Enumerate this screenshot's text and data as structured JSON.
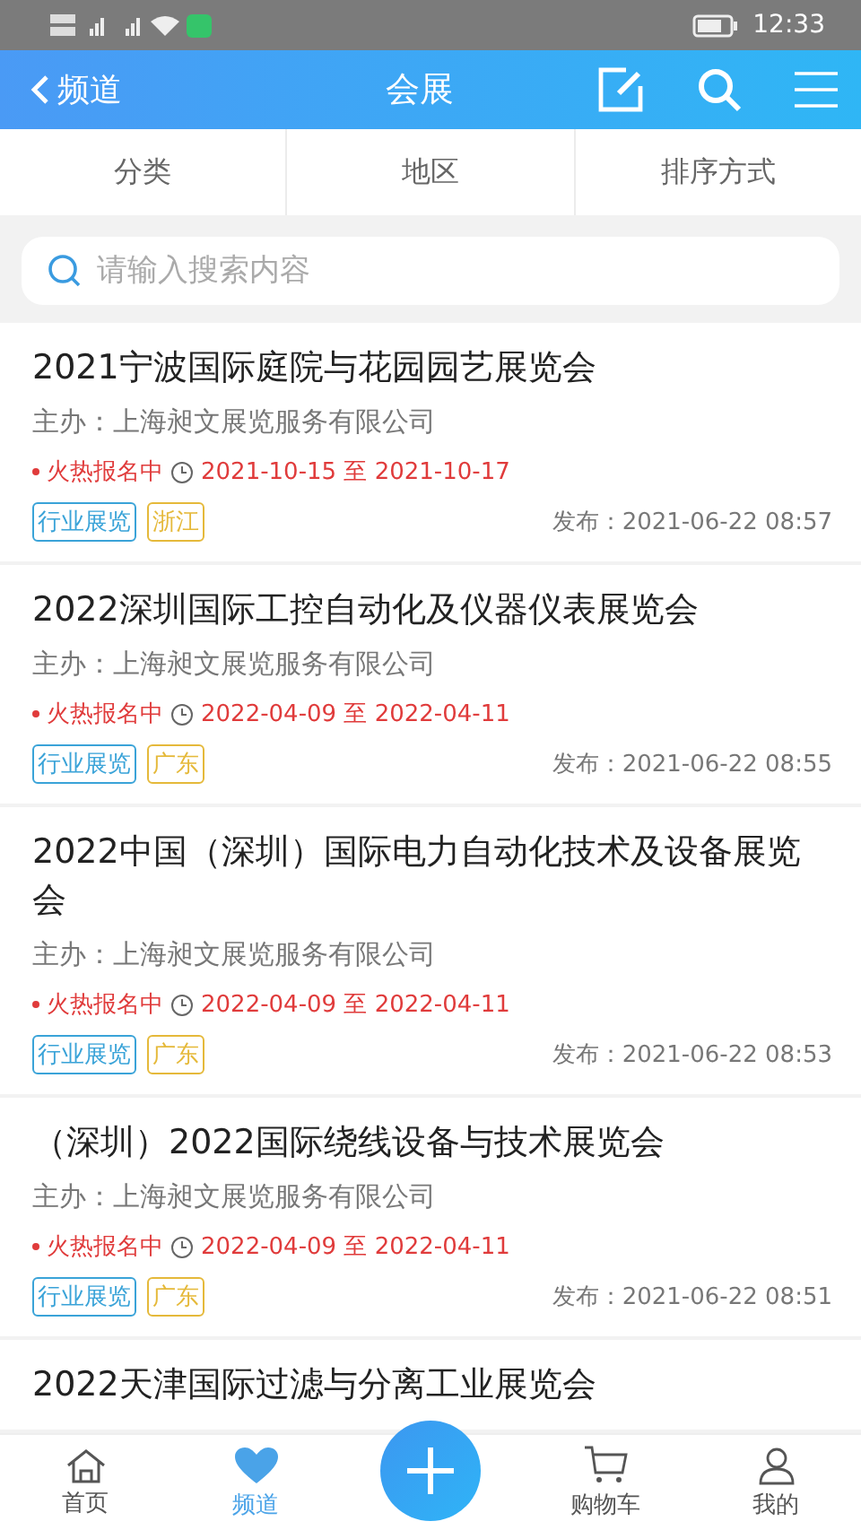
{
  "status_bar": {
    "time": "12:33"
  },
  "header": {
    "back_label": "频道",
    "title": "会展"
  },
  "filter_tabs": [
    {
      "label": "分类"
    },
    {
      "label": "地区"
    },
    {
      "label": "排序方式"
    }
  ],
  "search": {
    "placeholder": "请输入搜索内容"
  },
  "events": [
    {
      "title": "2021宁波国际庭院与花园园艺展览会",
      "organizer": "主办：上海昶文展览服务有限公司",
      "status": "火热报名中",
      "dates": "2021-10-15 至 2021-10-17",
      "tags": [
        {
          "text": "行业展览",
          "kind": "category"
        },
        {
          "text": "浙江",
          "kind": "region"
        }
      ],
      "published": "发布：2021-06-22 08:57"
    },
    {
      "title": "2022深圳国际工控自动化及仪器仪表展览会",
      "organizer": "主办：上海昶文展览服务有限公司",
      "status": "火热报名中",
      "dates": "2022-04-09 至 2022-04-11",
      "tags": [
        {
          "text": "行业展览",
          "kind": "category"
        },
        {
          "text": "广东",
          "kind": "region"
        }
      ],
      "published": "发布：2021-06-22 08:55"
    },
    {
      "title": "2022中国（深圳）国际电力自动化技术及设备展览会",
      "organizer": "主办：上海昶文展览服务有限公司",
      "status": "火热报名中",
      "dates": "2022-04-09 至 2022-04-11",
      "tags": [
        {
          "text": "行业展览",
          "kind": "category"
        },
        {
          "text": "广东",
          "kind": "region"
        }
      ],
      "published": "发布：2021-06-22 08:53"
    },
    {
      "title": "（深圳）2022国际绕线设备与技术展览会",
      "organizer": "主办：上海昶文展览服务有限公司",
      "status": "火热报名中",
      "dates": "2022-04-09 至 2022-04-11",
      "tags": [
        {
          "text": "行业展览",
          "kind": "category"
        },
        {
          "text": "广东",
          "kind": "region"
        }
      ],
      "published": "发布：2021-06-22 08:51"
    },
    {
      "title": "2022天津国际过滤与分离工业展览会"
    }
  ],
  "bottom_nav": [
    {
      "label": "首页",
      "kind": "home",
      "selected": false
    },
    {
      "label": "频道",
      "kind": "heart",
      "selected": true
    },
    {
      "kind": "add"
    },
    {
      "label": "购物车",
      "kind": "cart",
      "selected": false
    },
    {
      "label": "我的",
      "kind": "user",
      "selected": false
    }
  ]
}
